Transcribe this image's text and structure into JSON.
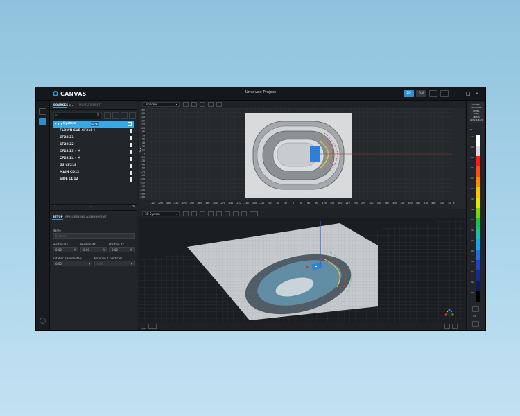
{
  "app": {
    "name": "CANVAS",
    "project_title": "Unsaved Project"
  },
  "titlebar": {
    "btn_2d": "2D",
    "btn_full": "Full"
  },
  "sources_panel": {
    "tab_sources": "SOURCES",
    "tab_measurement": "MEASUREMENT",
    "search_placeholder": "",
    "system": {
      "label": "System",
      "badge": "S1-X3"
    },
    "items": [
      {
        "label": "FLOWN SUB CF218 I+"
      },
      {
        "label": "CF28 Z1"
      },
      {
        "label": "CF28 Z2"
      },
      {
        "label": "CF28 Z3 - M"
      },
      {
        "label": "CF28 Z4 - M"
      },
      {
        "label": "GS CF218"
      },
      {
        "label": "MAIN CD12"
      },
      {
        "label": "SIDE CD12"
      }
    ]
  },
  "properties": {
    "tab_setup": "SETUP",
    "tab_processing": "PROCESSING",
    "tab_assignment": "ASSIGNMENT",
    "name_label": "Name",
    "name_value": "System",
    "pos_x_label": "Position dX",
    "pos_y_label": "Position dY",
    "pos_z_label": "Position dZ",
    "pos_x": "0.00",
    "pos_y": "0.00",
    "pos_z": "0.00",
    "unit": "ft",
    "rot_h_label": "Rotation (Horizontal)",
    "rot_v_label": "Rotation Y (Vertical)",
    "rot_h": "0.00",
    "rot_v": "0.00"
  },
  "top_view": {
    "view_select": "Top View",
    "y_ticks": [
      "180",
      "165",
      "150",
      "135",
      "120",
      "105",
      "90",
      "75",
      "60",
      "45",
      "30",
      "15",
      "0",
      "-15",
      "-30",
      "-45",
      "-60",
      "-75",
      "-90",
      "-105",
      "-120",
      "-135",
      "-150",
      "-165",
      "-180"
    ],
    "x_ticks": [
      "-20",
      "-490",
      "-480",
      "-450",
      "-420",
      "-390",
      "-360",
      "-330",
      "-300",
      "-270",
      "-240",
      "-210",
      "-180",
      "-150",
      "-120",
      "-90",
      "-60",
      "-30",
      "0",
      "30",
      "60",
      "90",
      "120",
      "150",
      "180",
      "210",
      "240",
      "270",
      "300",
      "330",
      "360",
      "390",
      "420",
      "450",
      "480",
      "510",
      "540",
      "570",
      "14"
    ],
    "x_unit": "ft"
  },
  "view_3d": {
    "view_select": "3D System"
  },
  "right_panel": {
    "header_lines": [
      "SOUND",
      "PRESSURE",
      "LEVEL",
      "(SPL)",
      "dB SPL",
      "1kHz 1/3oct"
    ],
    "scale_label": "dB",
    "scale_values": [
      "110",
      "108",
      "106",
      "104",
      "102",
      "100",
      "98",
      "96",
      "94",
      "92",
      "90",
      "88",
      "86",
      "84",
      "82",
      "80"
    ],
    "scale_colors": [
      "#ffffff",
      "#d9d9d9",
      "#ff1a1a",
      "#ff4d1a",
      "#ff8a00",
      "#ffc400",
      "#e6e600",
      "#7bd500",
      "#19c24a",
      "#19c2a4",
      "#19a6e6",
      "#1f6fe0",
      "#2343c4",
      "#1a2a8c",
      "#101a55",
      "#000000"
    ],
    "bottom_label": "1/8"
  },
  "colors": {
    "accent": "#2f8fcf",
    "selection": "#37a9e6",
    "bg_dark": "#1e2226"
  }
}
